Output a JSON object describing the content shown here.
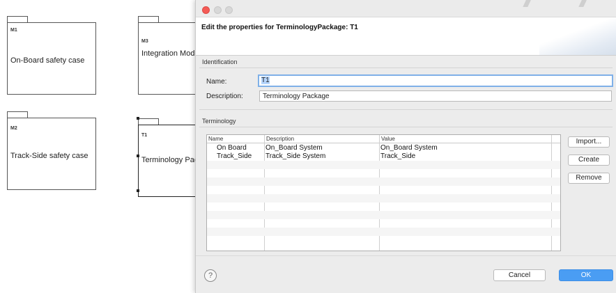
{
  "canvas": {
    "packages": [
      {
        "id": "M1",
        "name": "On-Board safety case"
      },
      {
        "id": "M3",
        "name": "Integration Mod"
      },
      {
        "id": "M2",
        "name": "Track-Side safety case"
      },
      {
        "id": "T1",
        "name": "Terminology Pac"
      }
    ]
  },
  "dialog": {
    "heading": "Edit the properties for TerminologyPackage: T1",
    "identification": {
      "title": "Identification",
      "name_label": "Name:",
      "name_value": "T1",
      "description_label": "Description:",
      "description_value": "Terminology Package"
    },
    "terminology": {
      "title": "Terminology",
      "columns": [
        "Name",
        "Description",
        "Value"
      ],
      "rows": [
        {
          "name": "On Board",
          "description": "On_Board System",
          "value": "On_Board System"
        },
        {
          "name": "Track_Side",
          "description": "Track_Side System",
          "value": "Track_Side"
        }
      ],
      "buttons": {
        "import": "Import...",
        "create": "Create",
        "remove": "Remove"
      }
    },
    "footer": {
      "help": "?",
      "cancel": "Cancel",
      "ok": "OK"
    },
    "colors": {
      "ok_button": "#4a9df3",
      "close_button": "#f45b56",
      "focus_ring": "#7fb0e8"
    }
  }
}
